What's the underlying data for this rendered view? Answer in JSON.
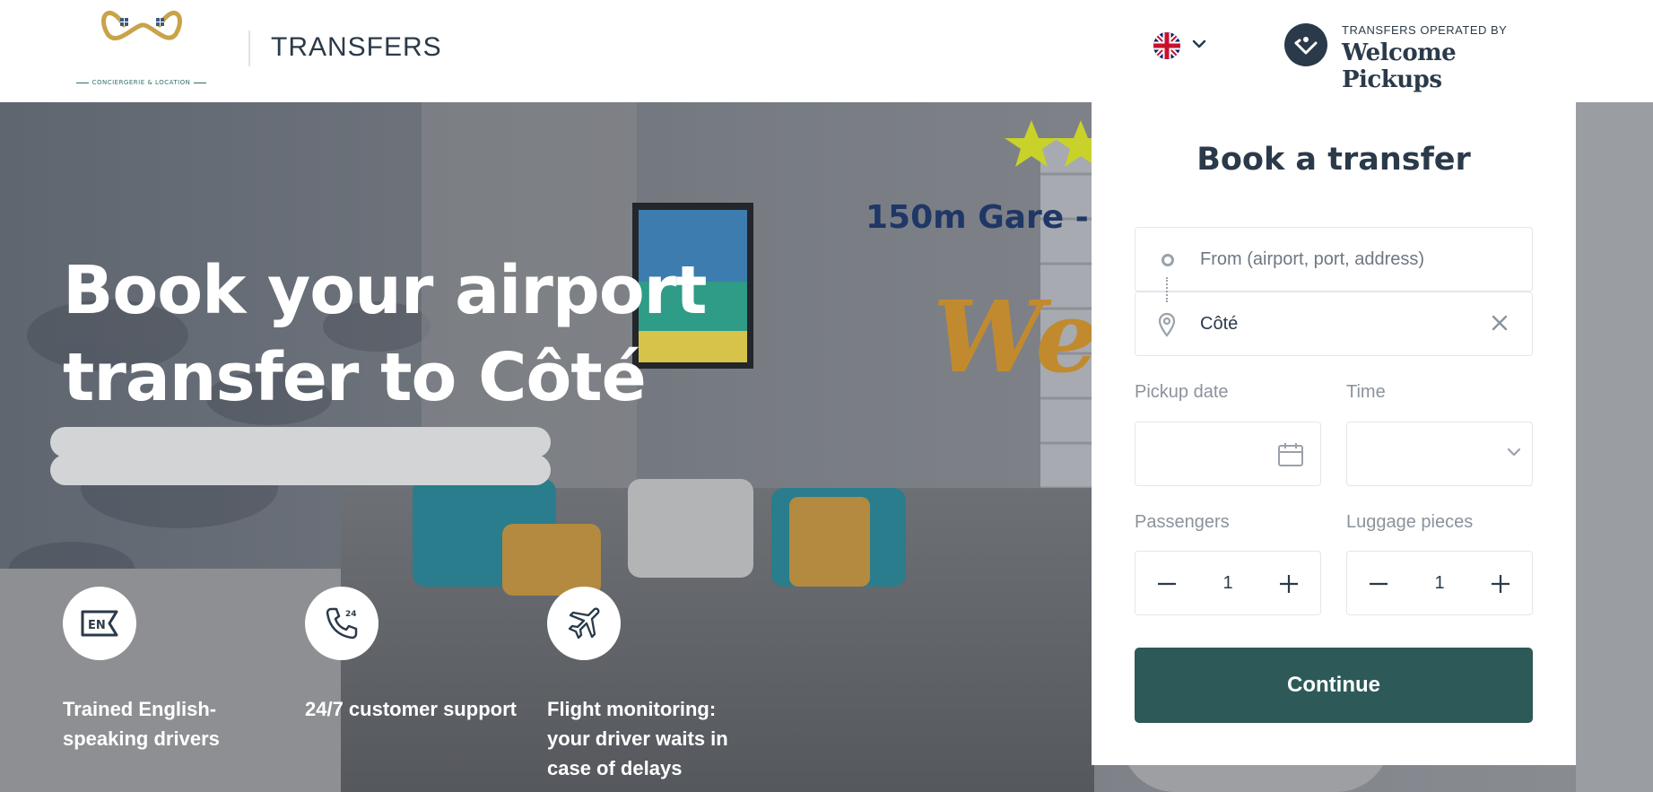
{
  "header": {
    "logo_tagline": "CONCIERGERIE & LOCATION",
    "brand_title": "TRANSFERS",
    "language_flag": "uk-flag-icon",
    "operated_by_small": "TRANSFERS OPERATED BY",
    "operated_by_name": "Welcome Pickups"
  },
  "hero": {
    "title": "Book your airport transfer to Côté",
    "features": [
      {
        "icon": "english-badge-icon",
        "badge": "EN",
        "text": "Trained English-speaking drivers"
      },
      {
        "icon": "phone-24-icon",
        "text": "24/7 customer support"
      },
      {
        "icon": "airplane-icon",
        "text": "Flight monitoring: your driver waits in case of delays"
      }
    ]
  },
  "booking": {
    "title": "Book a transfer",
    "from_placeholder": "From (airport, port, address)",
    "to_value": "Côté",
    "pickup_date_label": "Pickup date",
    "time_label": "Time",
    "passengers_label": "Passengers",
    "passengers_value": "1",
    "luggage_label": "Luggage pieces",
    "luggage_value": "1",
    "continue_label": "Continue"
  },
  "colors": {
    "primary": "#2d5a58",
    "text_dark": "#2b3a4a",
    "muted": "#8a939c"
  }
}
